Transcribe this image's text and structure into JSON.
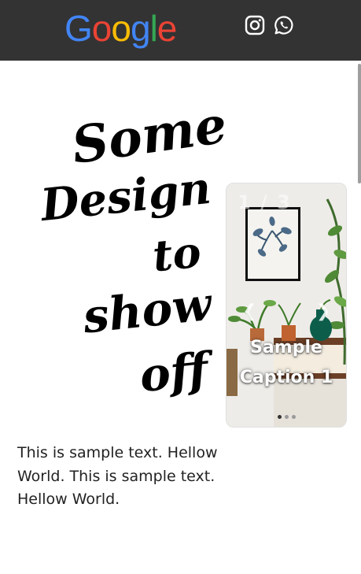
{
  "header": {
    "logo": {
      "letters": [
        "G",
        "o",
        "o",
        "g",
        "l",
        "e"
      ],
      "colors": [
        "#4285F4",
        "#EA4335",
        "#FBBC05",
        "#4285F4",
        "#34A853",
        "#EA4335"
      ]
    },
    "social": [
      {
        "name": "instagram-icon",
        "color": "#ffffff"
      },
      {
        "name": "whatsapp-icon",
        "color": "#ffffff"
      }
    ],
    "background": "#333333"
  },
  "hero": {
    "headline_lines": [
      "Some",
      "Design",
      "to",
      "show",
      "off"
    ],
    "body_text": "This is sample text. Hellow World. This is sample text. Hellow World."
  },
  "carousel": {
    "counter": "1 / 3",
    "caption_line1": "Sample",
    "caption_line2": "Caption 1",
    "prev_glyph": "❮",
    "next_glyph": "❯",
    "slide_count": 3,
    "active_index": 0
  }
}
